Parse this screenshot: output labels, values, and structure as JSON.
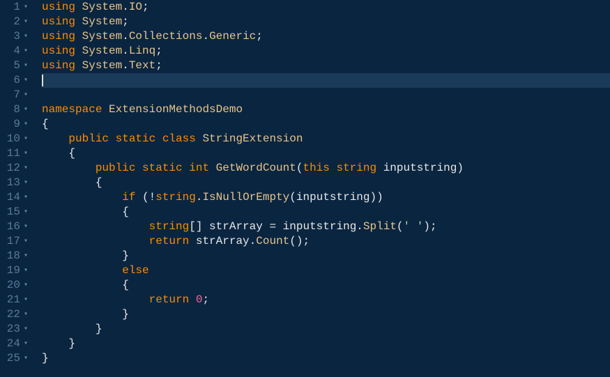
{
  "gutter": {
    "lines": [
      {
        "n": 1,
        "fold": true
      },
      {
        "n": 2,
        "fold": false
      },
      {
        "n": 3,
        "fold": false
      },
      {
        "n": 4,
        "fold": false
      },
      {
        "n": 5,
        "fold": false
      },
      {
        "n": 6,
        "fold": false
      },
      {
        "n": 7,
        "fold": false
      },
      {
        "n": 8,
        "fold": false
      },
      {
        "n": 9,
        "fold": true
      },
      {
        "n": 10,
        "fold": false
      },
      {
        "n": 11,
        "fold": true
      },
      {
        "n": 12,
        "fold": false
      },
      {
        "n": 13,
        "fold": true
      },
      {
        "n": 14,
        "fold": false
      },
      {
        "n": 15,
        "fold": true
      },
      {
        "n": 16,
        "fold": false
      },
      {
        "n": 17,
        "fold": false
      },
      {
        "n": 18,
        "fold": false
      },
      {
        "n": 19,
        "fold": false
      },
      {
        "n": 20,
        "fold": true
      },
      {
        "n": 21,
        "fold": false
      },
      {
        "n": 22,
        "fold": false
      },
      {
        "n": 23,
        "fold": false
      },
      {
        "n": 24,
        "fold": false
      },
      {
        "n": 25,
        "fold": false
      }
    ],
    "fold_marker": "▾"
  },
  "code": {
    "active_line": 6,
    "lines": [
      [
        {
          "t": "using ",
          "c": "tk-keyword"
        },
        {
          "t": "System",
          "c": "tk-type"
        },
        {
          "t": ".",
          "c": "tk-punct"
        },
        {
          "t": "IO",
          "c": "tk-type"
        },
        {
          "t": ";",
          "c": "tk-punct"
        }
      ],
      [
        {
          "t": "using ",
          "c": "tk-keyword"
        },
        {
          "t": "System",
          "c": "tk-type"
        },
        {
          "t": ";",
          "c": "tk-punct"
        }
      ],
      [
        {
          "t": "using ",
          "c": "tk-keyword"
        },
        {
          "t": "System",
          "c": "tk-type"
        },
        {
          "t": ".",
          "c": "tk-punct"
        },
        {
          "t": "Collections",
          "c": "tk-type"
        },
        {
          "t": ".",
          "c": "tk-punct"
        },
        {
          "t": "Generic",
          "c": "tk-type"
        },
        {
          "t": ";",
          "c": "tk-punct"
        }
      ],
      [
        {
          "t": "using ",
          "c": "tk-keyword"
        },
        {
          "t": "System",
          "c": "tk-type"
        },
        {
          "t": ".",
          "c": "tk-punct"
        },
        {
          "t": "Linq",
          "c": "tk-type"
        },
        {
          "t": ";",
          "c": "tk-punct"
        }
      ],
      [
        {
          "t": "using ",
          "c": "tk-keyword"
        },
        {
          "t": "System",
          "c": "tk-type"
        },
        {
          "t": ".",
          "c": "tk-punct"
        },
        {
          "t": "Text",
          "c": "tk-type"
        },
        {
          "t": ";",
          "c": "tk-punct"
        }
      ],
      [],
      [],
      [
        {
          "t": "namespace ",
          "c": "tk-namespace"
        },
        {
          "t": "ExtensionMethodsDemo",
          "c": "tk-class"
        }
      ],
      [
        {
          "t": "{",
          "c": "tk-punct"
        }
      ],
      [
        {
          "t": "    ",
          "c": ""
        },
        {
          "t": "public static class ",
          "c": "tk-keyword"
        },
        {
          "t": "StringExtension",
          "c": "tk-class"
        }
      ],
      [
        {
          "t": "    ",
          "c": ""
        },
        {
          "t": "{",
          "c": "tk-punct"
        }
      ],
      [
        {
          "t": "        ",
          "c": ""
        },
        {
          "t": "public static int ",
          "c": "tk-keyword"
        },
        {
          "t": "GetWordCount",
          "c": "tk-method"
        },
        {
          "t": "(",
          "c": "tk-punct"
        },
        {
          "t": "this string ",
          "c": "tk-keyword"
        },
        {
          "t": "inputstring",
          "c": "tk-ident"
        },
        {
          "t": ")",
          "c": "tk-punct"
        }
      ],
      [
        {
          "t": "        ",
          "c": ""
        },
        {
          "t": "{",
          "c": "tk-punct"
        }
      ],
      [
        {
          "t": "            ",
          "c": ""
        },
        {
          "t": "if ",
          "c": "tk-keyword"
        },
        {
          "t": "(!",
          "c": "tk-punct"
        },
        {
          "t": "string",
          "c": "tk-keyword"
        },
        {
          "t": ".",
          "c": "tk-punct"
        },
        {
          "t": "IsNullOrEmpty",
          "c": "tk-method"
        },
        {
          "t": "(",
          "c": "tk-punct"
        },
        {
          "t": "inputstring",
          "c": "tk-ident"
        },
        {
          "t": "))",
          "c": "tk-punct"
        }
      ],
      [
        {
          "t": "            ",
          "c": ""
        },
        {
          "t": "{",
          "c": "tk-punct"
        }
      ],
      [
        {
          "t": "                ",
          "c": ""
        },
        {
          "t": "string",
          "c": "tk-keyword"
        },
        {
          "t": "[] ",
          "c": "tk-punct"
        },
        {
          "t": "strArray",
          "c": "tk-ident"
        },
        {
          "t": " = ",
          "c": "tk-punct"
        },
        {
          "t": "inputstring",
          "c": "tk-ident"
        },
        {
          "t": ".",
          "c": "tk-punct"
        },
        {
          "t": "Split",
          "c": "tk-method"
        },
        {
          "t": "(",
          "c": "tk-punct"
        },
        {
          "t": "' '",
          "c": "tk-string"
        },
        {
          "t": ");",
          "c": "tk-punct"
        }
      ],
      [
        {
          "t": "                ",
          "c": ""
        },
        {
          "t": "return ",
          "c": "tk-keyword"
        },
        {
          "t": "strArray",
          "c": "tk-ident"
        },
        {
          "t": ".",
          "c": "tk-punct"
        },
        {
          "t": "Count",
          "c": "tk-method"
        },
        {
          "t": "();",
          "c": "tk-punct"
        }
      ],
      [
        {
          "t": "            ",
          "c": ""
        },
        {
          "t": "}",
          "c": "tk-punct"
        }
      ],
      [
        {
          "t": "            ",
          "c": ""
        },
        {
          "t": "else",
          "c": "tk-keyword"
        }
      ],
      [
        {
          "t": "            ",
          "c": ""
        },
        {
          "t": "{",
          "c": "tk-punct"
        }
      ],
      [
        {
          "t": "                ",
          "c": ""
        },
        {
          "t": "return ",
          "c": "tk-keyword"
        },
        {
          "t": "0",
          "c": "tk-number"
        },
        {
          "t": ";",
          "c": "tk-punct"
        }
      ],
      [
        {
          "t": "            ",
          "c": ""
        },
        {
          "t": "}",
          "c": "tk-punct"
        }
      ],
      [
        {
          "t": "        ",
          "c": ""
        },
        {
          "t": "}",
          "c": "tk-punct"
        }
      ],
      [
        {
          "t": "    ",
          "c": ""
        },
        {
          "t": "}",
          "c": "tk-punct"
        }
      ],
      [
        {
          "t": "}",
          "c": "tk-punct"
        }
      ]
    ]
  }
}
